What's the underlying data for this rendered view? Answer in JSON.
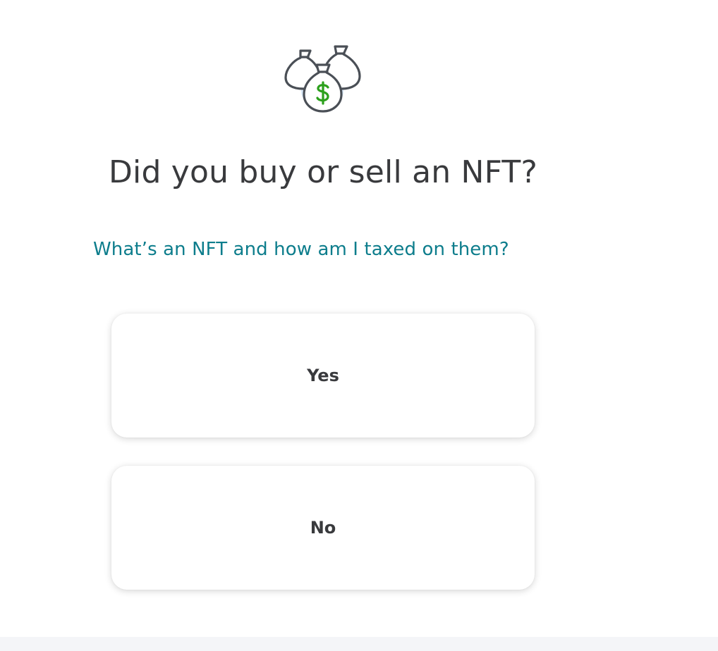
{
  "hero": {
    "icon": "money-bags-icon",
    "colors": {
      "outline": "#4a4f56",
      "dollar": "#2ca01c",
      "glow": "#cfe3f7"
    }
  },
  "question": {
    "title": "Did you buy or sell an NFT?"
  },
  "help": {
    "link_text": "What’s an NFT and how am I taxed on them?",
    "color": "#0d7d8c"
  },
  "choices": [
    {
      "label": "Yes"
    },
    {
      "label": "No"
    }
  ]
}
